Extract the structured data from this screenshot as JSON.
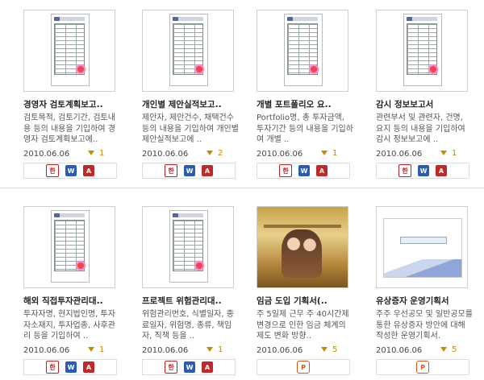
{
  "row1": [
    {
      "title": "경영자 검토계획보고..",
      "desc": "검토목적, 검토기간, 검토내용 등의 내용을 기입하여 경영자 검토계획보고에..",
      "date": "2010.06.06",
      "downloads": "1",
      "formats": [
        "hwp",
        "doc",
        "pdf"
      ],
      "thumb": "doc"
    },
    {
      "title": "개인별 제안실적보고..",
      "desc": "제안자, 제안건수, 채택건수 등의 내용을 기입하여 개인별 제안실적보고에 ..",
      "date": "2010.06.06",
      "downloads": "2",
      "formats": [
        "hwp",
        "doc",
        "pdf"
      ],
      "thumb": "doc"
    },
    {
      "title": "개별 포트폴리오 요..",
      "desc": "Portfolio명, 총 투자금액, 투자기간 등의 내용을 기입하여 개별 ..",
      "date": "2010.06.06",
      "downloads": "1",
      "formats": [
        "hwp",
        "doc",
        "pdf"
      ],
      "thumb": "doc"
    },
    {
      "title": "감시 정보보고서",
      "desc": "관련부서 및 관련자, 건명, 요지 등의 내용을 기입하여 감시 정보보고에 ..",
      "date": "2010.06.06",
      "downloads": "1",
      "formats": [
        "hwp",
        "doc",
        "pdf"
      ],
      "thumb": "doc"
    }
  ],
  "row2": [
    {
      "title": "해외 직접투자관리대..",
      "desc": "투자자명, 현지법인명, 투자자소재지, 투자업종, 사후관리 등을 기입하여 ..",
      "date": "2010.06.06",
      "downloads": "1",
      "formats": [
        "hwp",
        "doc",
        "pdf"
      ],
      "thumb": "doc"
    },
    {
      "title": "프로젝트 위험관리대..",
      "desc": "위험관리번호, 식별일자, 종료일자, 위험명, 종류, 책임자, 직책 등을 ..",
      "date": "2010.06.06",
      "downloads": "1",
      "formats": [
        "hwp",
        "doc",
        "pdf"
      ],
      "thumb": "doc"
    },
    {
      "title": "임금 도입 기획서(..",
      "desc": "주 5일제 근무 주 40시간제 변경으로 인한 임금 체계의 제도 변화 방향..",
      "date": "2010.06.06",
      "downloads": "5",
      "formats": [
        "ppt"
      ],
      "thumb": "photo"
    },
    {
      "title": "유상증자 운영기획서",
      "desc": "주주 우선공모 및 일반공모를 통한 유상증자 방안에 대해 작성한 운영기획서.",
      "date": "2010.06.06",
      "downloads": "5",
      "formats": [
        "ppt"
      ],
      "thumb": "slide"
    }
  ],
  "format_labels": {
    "hwp": "한",
    "doc": "W",
    "pdf": "A",
    "ppt": "P"
  },
  "colors": {
    "download": "#c98a00",
    "hwp": "#b22222",
    "doc": "#2a5bb8",
    "pdf": "#c0282a",
    "ppt": "#d35a1a"
  }
}
